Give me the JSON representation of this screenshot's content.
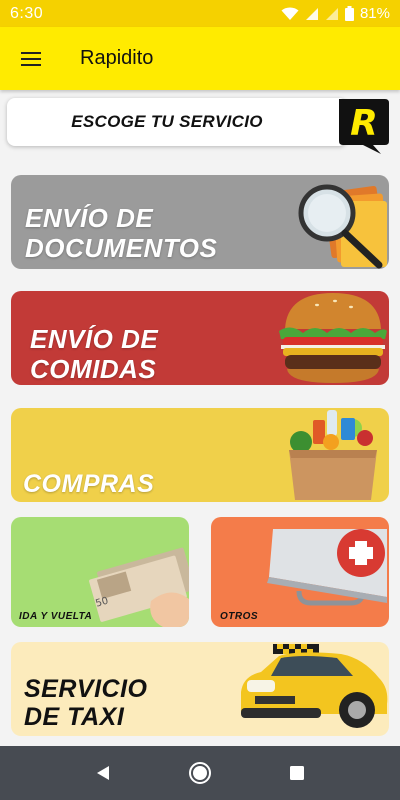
{
  "status_bar": {
    "time": "6:30",
    "battery": "81%",
    "icons": [
      "wifi-icon",
      "signal-icon",
      "signal-icon",
      "battery-icon"
    ]
  },
  "app_bar": {
    "title": "Rapidito",
    "menu_icon": "menu-icon"
  },
  "header": {
    "text": "ESCOGE TU SERVICIO",
    "logo_letter": "R"
  },
  "services": {
    "documents": {
      "line1": "ENVÍO DE",
      "line2": "DOCUMENTOS",
      "color": "#9b9b9b"
    },
    "food": {
      "line1": "ENVÍO DE",
      "line2": "COMIDAS",
      "color": "#c23a37"
    },
    "shopping": {
      "label": "COMPRAS",
      "color": "#f0d04a"
    },
    "round_trip": {
      "label": "IDA Y VUELTA",
      "color": "#a6dd73"
    },
    "others": {
      "label": "OTROS",
      "color": "#f47c4a"
    },
    "taxi": {
      "line1": "SERVICIO",
      "line2": "DE TAXI",
      "color": "#fcebbc"
    }
  },
  "nav_bar": {
    "icons": [
      "back-icon",
      "home-icon",
      "recents-icon"
    ]
  },
  "colors": {
    "accent": "#ffeb00",
    "status": "#f5d100",
    "nav": "#474b52"
  }
}
